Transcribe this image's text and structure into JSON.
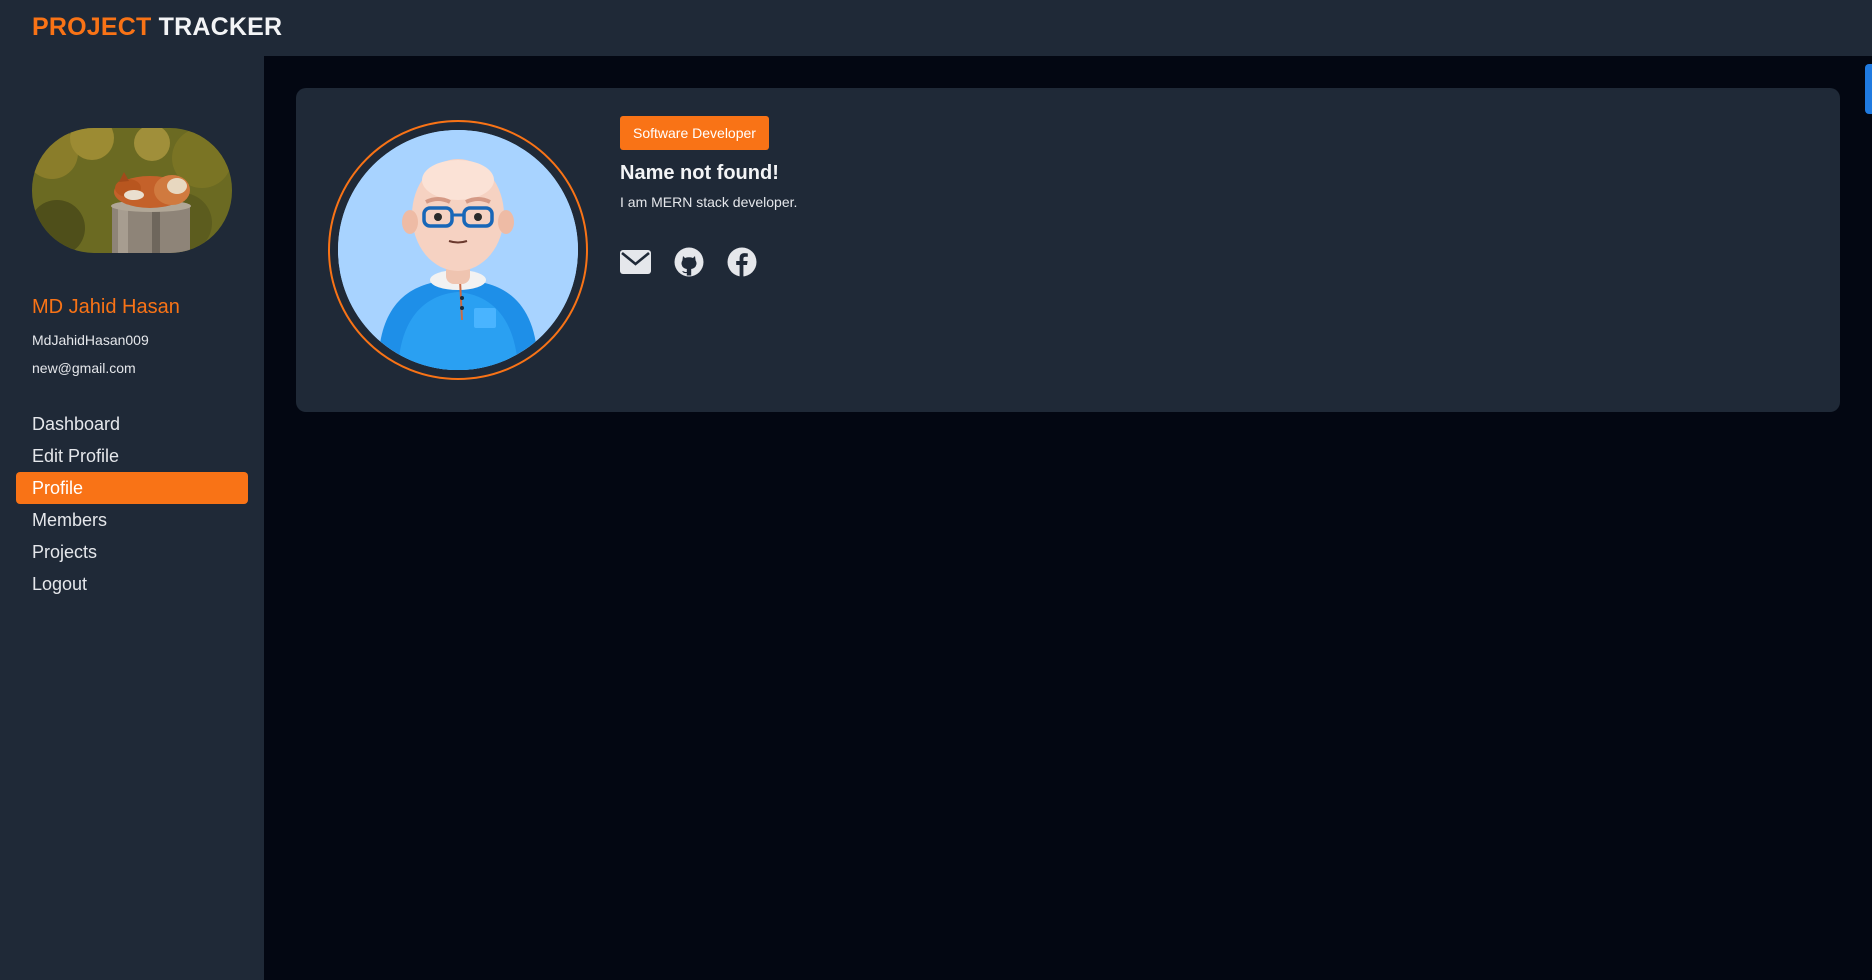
{
  "header": {
    "brand_accent": "PROJECT",
    "brand_rest": "TRACKER"
  },
  "sidebar": {
    "user": {
      "name": "MD Jahid Hasan",
      "username": "MdJahidHasan009",
      "email": "new@gmail.com"
    },
    "nav": [
      {
        "label": "Dashboard",
        "active": false
      },
      {
        "label": "Edit Profile",
        "active": false
      },
      {
        "label": "Profile",
        "active": true
      },
      {
        "label": "Members",
        "active": false
      },
      {
        "label": "Projects",
        "active": false
      },
      {
        "label": "Logout",
        "active": false
      }
    ]
  },
  "profile": {
    "role_badge": "Software Developer",
    "name": "Name not found!",
    "bio": "I am MERN stack developer.",
    "social_icons": [
      "email-icon",
      "github-icon",
      "facebook-icon"
    ]
  },
  "colors": {
    "accent": "#f97316",
    "panel": "#1f2937",
    "background": "#030712",
    "edge_tab": "#1f7ae0"
  }
}
